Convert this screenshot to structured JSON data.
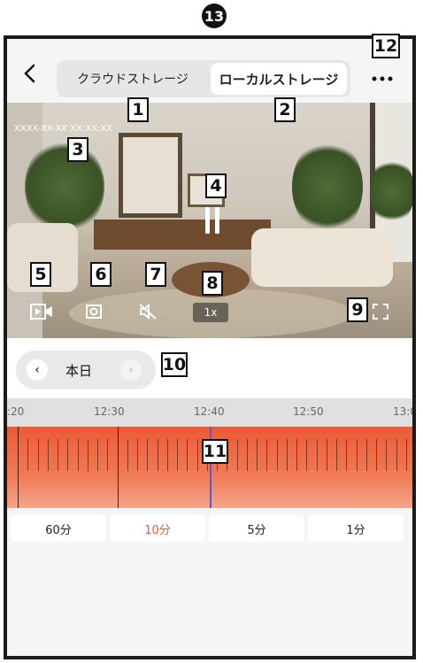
{
  "figure_badge": "13",
  "header": {
    "back_icon": "chevron-left-icon",
    "tabs": [
      {
        "label": "クラウドストレージ",
        "active": false
      },
      {
        "label": "ローカルストレージ",
        "active": true
      }
    ],
    "more_icon": "more-dots-icon"
  },
  "video": {
    "timestamp": "XXXX-XX-XX XX:XX:XX",
    "speed_label": "1x",
    "controls": [
      "record-icon",
      "snapshot-icon",
      "mute-icon",
      "fullscreen-icon"
    ]
  },
  "date_nav": {
    "prev_symbol": "‹",
    "label": "本日",
    "next_symbol": "›"
  },
  "ruler": {
    "labels": [
      ":20",
      "12:30",
      "12:40",
      "12:50",
      "13:0"
    ]
  },
  "zoom": {
    "options": [
      {
        "label": "60分",
        "active": false
      },
      {
        "label": "10分",
        "active": true
      },
      {
        "label": "5分",
        "active": false
      },
      {
        "label": "1分",
        "active": false
      }
    ]
  },
  "callouts": [
    "1",
    "2",
    "3",
    "4",
    "5",
    "6",
    "7",
    "8",
    "9",
    "10",
    "11",
    "12"
  ],
  "colors": {
    "accent": "#ee5a2e",
    "timeline": "#ec5a36",
    "cursor": "#5a5ad8"
  }
}
